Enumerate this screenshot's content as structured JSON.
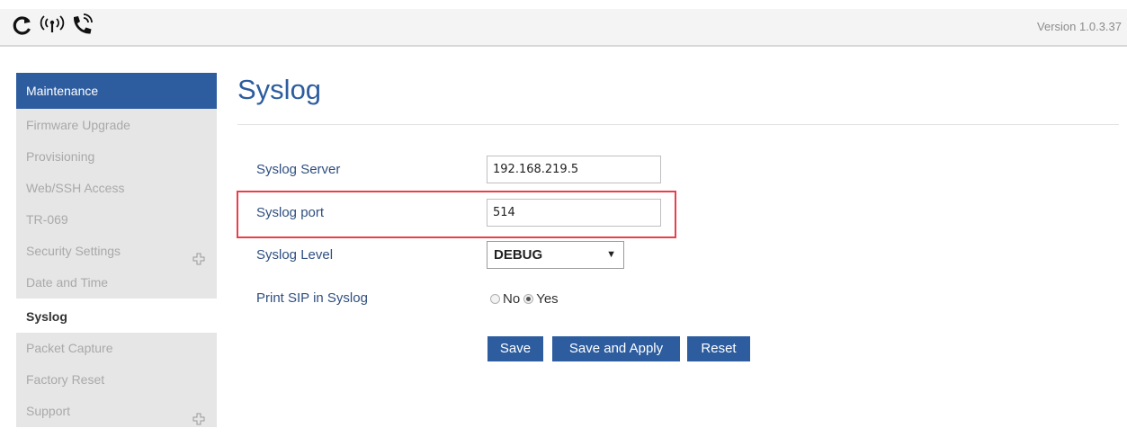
{
  "header": {
    "icons": [
      "refresh-icon",
      "wireless-signal-icon",
      "phone-ringing-icon"
    ],
    "version": "Version 1.0.3.37"
  },
  "sidebar": {
    "section": "Maintenance",
    "items": [
      {
        "label": "Firmware Upgrade"
      },
      {
        "label": "Provisioning"
      },
      {
        "label": "Web/SSH Access"
      },
      {
        "label": "TR-069"
      },
      {
        "label": "Security Settings",
        "expandable": true
      },
      {
        "label": "Date and Time"
      },
      {
        "label": "Syslog",
        "active": true
      },
      {
        "label": "Packet Capture"
      },
      {
        "label": "Factory Reset"
      },
      {
        "label": "Support",
        "expandable": true
      }
    ]
  },
  "main": {
    "title": "Syslog",
    "fields": {
      "server": {
        "label": "Syslog Server",
        "value": "192.168.219.5"
      },
      "port": {
        "label": "Syslog port",
        "value": "514"
      },
      "level": {
        "label": "Syslog Level",
        "value": "DEBUG"
      },
      "print_sip": {
        "label": "Print SIP in Syslog",
        "options": [
          "No",
          "Yes"
        ],
        "selected": "Yes"
      }
    },
    "buttons": {
      "save": "Save",
      "save_apply": "Save and Apply",
      "reset": "Reset"
    }
  },
  "colors": {
    "accent": "#2d5d9f",
    "highlight": "#e8404b"
  }
}
